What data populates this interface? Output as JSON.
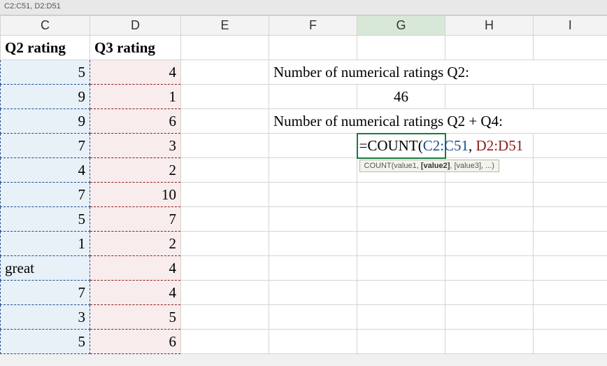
{
  "namebox": "C2:C51, D2:D51",
  "columns": [
    "C",
    "D",
    "E",
    "F",
    "G",
    "H",
    "I"
  ],
  "active_col": "G",
  "headers": {
    "C": "Q2 rating",
    "D": "Q3 rating"
  },
  "rows": [
    {
      "C": "5",
      "D": "4"
    },
    {
      "C": "9",
      "D": "1"
    },
    {
      "C": "9",
      "D": "6"
    },
    {
      "C": "7",
      "D": "3"
    },
    {
      "C": "4",
      "D": "2"
    },
    {
      "C": "7",
      "D": "10"
    },
    {
      "C": "5",
      "D": "7"
    },
    {
      "C": "1",
      "D": "2"
    },
    {
      "C": "great",
      "D": "4",
      "C_is_text": true
    },
    {
      "C": "7",
      "D": "4"
    },
    {
      "C": "3",
      "D": "5"
    },
    {
      "C": "5",
      "D": "6"
    }
  ],
  "labels": {
    "q2_label": "Number of numerical ratings Q2:",
    "q2_value": "46",
    "q2q4_label": "Number of numerical ratings Q2 + Q4:"
  },
  "formula": {
    "eq": "=",
    "fn": "COUNT",
    "open": "(",
    "range1": "C2:C51",
    "comma": ", ",
    "range2": "D2:D51"
  },
  "hint": {
    "fn": "COUNT(",
    "p1": "value1, ",
    "bold": "[value2]",
    "rest": ", [value3], ...)"
  },
  "colors": {
    "range1": "#1a4d8f",
    "range2": "#8b1a1a",
    "active_border": "#1c7a3e"
  },
  "chart_data": {
    "type": "table",
    "title": "Spreadsheet snippet with COUNT formula demo",
    "columns": [
      "Q2 rating",
      "Q3 rating"
    ],
    "data": [
      [
        5,
        4
      ],
      [
        9,
        1
      ],
      [
        9,
        6
      ],
      [
        7,
        3
      ],
      [
        4,
        2
      ],
      [
        7,
        10
      ],
      [
        5,
        7
      ],
      [
        1,
        2
      ],
      [
        "great",
        4
      ],
      [
        7,
        4
      ],
      [
        3,
        5
      ],
      [
        5,
        6
      ]
    ],
    "derived": {
      "Number of numerical ratings Q2": 46,
      "formula_in_G5": "=COUNT(C2:C51, D2:D51"
    }
  }
}
